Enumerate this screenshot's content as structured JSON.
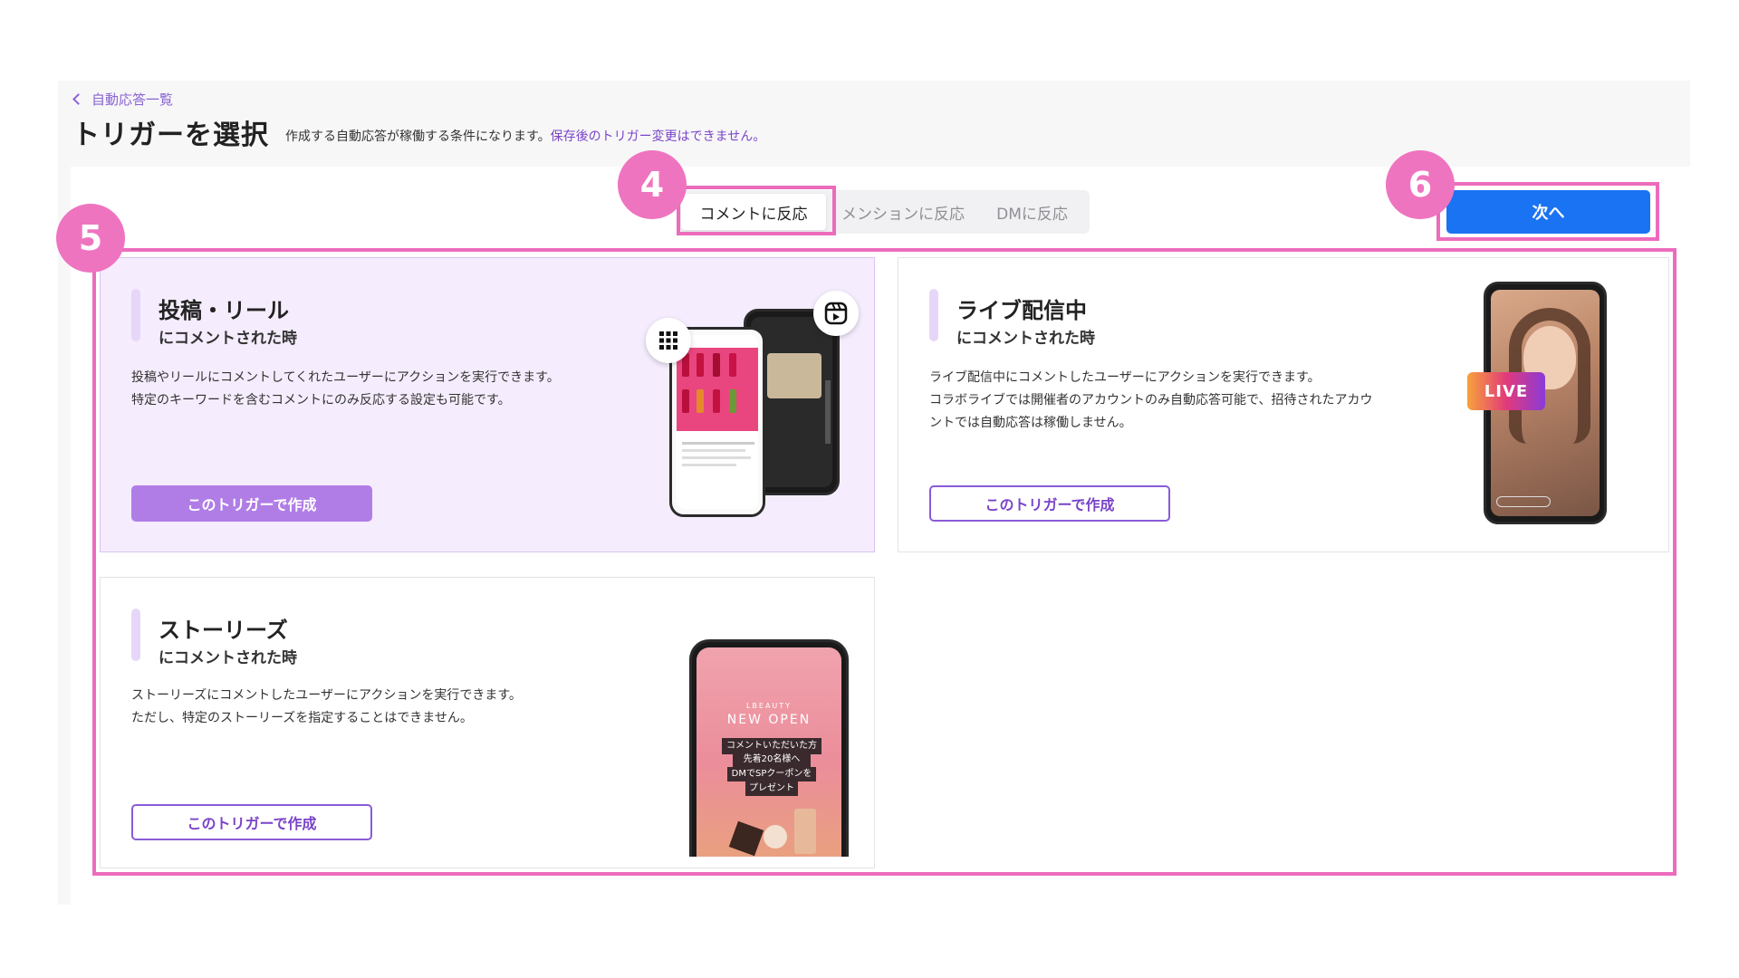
{
  "header": {
    "back_label": "自動応答一覧",
    "title": "トリガーを選択",
    "description": "作成する自動応答が稼働する条件になります。",
    "warning": "保存後のトリガー変更はできません。"
  },
  "tabs": [
    {
      "label": "コメントに反応",
      "active": true
    },
    {
      "label": "メンションに反応",
      "active": false
    },
    {
      "label": "DMに反応",
      "active": false
    }
  ],
  "next_button": "次へ",
  "badges": {
    "tab": "4",
    "cards": "5",
    "next": "6"
  },
  "cards": [
    {
      "title": "投稿・リール",
      "subtitle": "にコメントされた時",
      "description": [
        "投稿やリールにコメントしてくれたユーザーにアクションを実行できます。",
        "特定のキーワードを含むコメントにのみ反応する設定も可能です。"
      ],
      "button": "このトリガーで作成",
      "selected": true
    },
    {
      "title": "ライブ配信中",
      "subtitle": "にコメントされた時",
      "description": [
        "ライブ配信中にコメントしたユーザーにアクションを実行できます。",
        "コラボライブでは開催者のアカウントのみ自動応答可能で、招待されたアカウントでは自動応答は稼働しません。"
      ],
      "button": "このトリガーで作成",
      "selected": false,
      "live_tag": "LIVE"
    },
    {
      "title": "ストーリーズ",
      "subtitle": "にコメントされた時",
      "description": [
        "ストーリーズにコメントしたユーザーにアクションを実行できます。",
        "ただし、特定のストーリーズを指定することはできません。"
      ],
      "button": "このトリガーで作成",
      "selected": false,
      "story": {
        "brand": "LBEAUTY",
        "headline": "NEW OPEN",
        "lines": [
          "コメントいただいた方",
          "先着20名様へ",
          "DMでSPクーポンを",
          "プレゼント"
        ]
      }
    }
  ],
  "colors": {
    "accent": "#7a44c9",
    "primary": "#1a73f2",
    "highlight": "#ec6cbc"
  }
}
